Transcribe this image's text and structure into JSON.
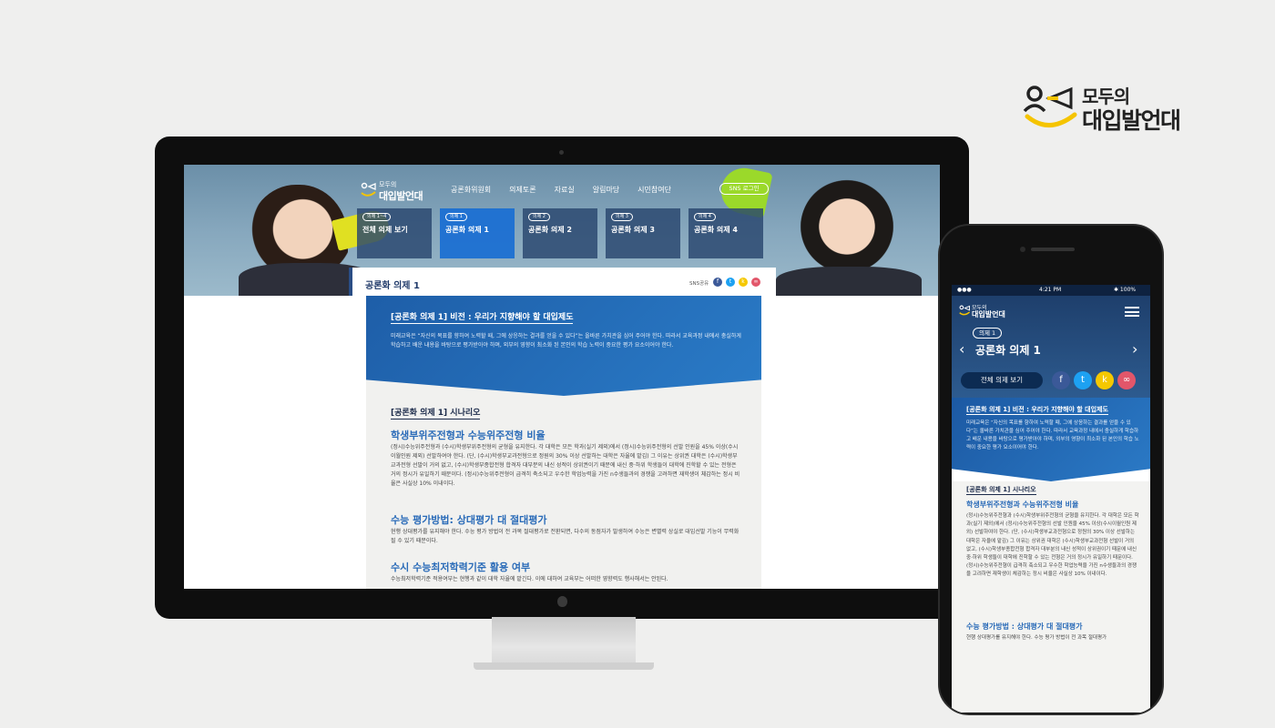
{
  "brand": {
    "line1": "모두의",
    "line2": "대입발언대"
  },
  "site": {
    "logo_line1": "모두의",
    "logo_line2": "대입발언대",
    "nav": [
      "공론화위원회",
      "의제토론",
      "자료실",
      "알림마당",
      "시민참여단"
    ],
    "sns_login": "SNS 로그인",
    "tabs": [
      {
        "badge": "의제 1~4",
        "title": "전체 의제 보기"
      },
      {
        "badge": "의제 1",
        "title": "공론화 의제 1"
      },
      {
        "badge": "의제 2",
        "title": "공론화 의제 2"
      },
      {
        "badge": "의제 3",
        "title": "공론화 의제 3"
      },
      {
        "badge": "의제 4",
        "title": "공론화 의제 4"
      }
    ],
    "active_tab": 1,
    "content_title": "공론화 의제 1",
    "share_label": "SNS공유",
    "share_icons": [
      "facebook-icon",
      "twitter-icon",
      "kakao-icon",
      "link-icon"
    ],
    "colors": {
      "accent": "#2a6bb8",
      "navy": "#1b2a4a",
      "facebook": "#3b5998",
      "twitter": "#1da1f2",
      "kakao": "#f5c800",
      "link": "#e2566a"
    }
  },
  "article": {
    "vision_title": "[공론화 의제 1] 비전 : 우리가 지향해야 할 대입제도",
    "vision_text": "미래교육은 “자신의 목표를 향하여 노력할 때, 그에 상응하는 결과를 얻을 수 있다”는 올바른 가치관을 심어 주어야 한다. 따라서 교육과정 내에서 충실하게 학습하고 배운 내용을 바탕으로 평가받아야 하며, 외부의 영향이 최소화 된 본인의 학습 노력이 중요한 평가 요소이어야 한다.",
    "scenario_title": "[공론화 의제 1] 시나리오",
    "sections": [
      {
        "title": "학생부위주전형과 수능위주전형 비율",
        "text": "(정시)수능위주전형과 (수시)학생부위주전형의 균형을 유지한다. 각 대학은 모든 학과(실기 제외)에서 (정시)수능위주전형의 선발 인원을 45% 이상(수시이월인원 제외) 선발하여야 한다. (단, (수시)학생부교과전형으로 정원의 30% 이상 선발하는 대학은 자율에 맡김) 그 이유는 상위권 대학은 (수시)학생부교과전형 선발이 거의 없고, (수시)학생부종합전형 합격자 대부분의 내신 성적이 상위권이기 때문에 내신 중·하위 학생들이 대학에 진학할 수 있는 전형은 거의 정시가 유일하기 때문이다. (정시)수능위주전형이 급격히 축소되고 우수한 학업능력을 가진 n수생들과의 경쟁을 고려하면 재학생이 체감하는 정시 비율은 사실상 10% 이내이다."
      },
      {
        "title": "수능 평가방법: 상대평가 대 절대평가",
        "text": "현행 상대평가를 유지해야 한다. 수능 평가 방법이 전 과목 절대평가로 전환되면, 다수의 동점자가 발생하여 수능은 변별력 상실로 대입선발 기능이 무력화될 수 있기 때문이다."
      },
      {
        "title": "수시 수능최저학력기준 활용 여부",
        "text": "수능최저학력기준 적용여부는 현행과 같이 대학 자율에 맡긴다. 이에 대하여 교육부는 어떠한 영향력도 행사해서는 안된다."
      }
    ]
  },
  "phone": {
    "status_left": "●●● ",
    "status_time": "4:21 PM",
    "status_battery": "✱ 100%",
    "logo_line1": "모두의",
    "logo_line2": "대입발언대",
    "badge": "의제 1",
    "title": "공론화 의제 1",
    "view_all": "전체 의제 보기",
    "vision_title": "[공론화 의제 1] 비전 : 우리가 지향해야 할 대입제도",
    "vision_text": "미래교육은 “자신의 목표를 향하여 노력할 때, 그에 상응하는 결과를 얻을 수 있다”는 올바른 가치관을 심어 주어야 한다. 따라서 교육과정 내에서 충실하게 학습하고 배운 내용을 바탕으로 평가받아야 하며, 외부의 영향이 최소화 된 본인의 학습 노력이 중요한 평가 요소이어야 한다.",
    "scenario_title": "[공론화 의제 1] 시나리오",
    "sec1_title": "학생부위주전형과 수능위주전형 비율",
    "sec1_text": "(정시)수능위주전형과 (수시)학생부위주전형의 균형을 유지한다. 각 대학은 모든 학과(실기 제외)에서 (정시)수능위주전형의 선발 인원을 45% 이상(수시이월인원 제외) 선발하여야 한다. (단, (수시)학생부교과전형으로 정원의 30% 이상 선발하는 대학은 자율에 맡김) 그 이유는 상위권 대학은 (수시)학생부교과전형 선발이 거의 없고, (수시)학생부종합전형 합격자 대부분의 내신 성적이 상위권이기 때문에 내신 중·하위 학생들이 대학에 진학할 수 있는 전형은 거의 정시가 유일하기 때문이다. (정시)수능위주전형이 급격히 축소되고 우수한 학업능력을 가진 n수생들과의 경쟁을 고려하면 재학생이 체감하는 정시 비율은 사실상 10% 이내이다.",
    "sec2_title": "수능 평가방법 : 상대평가 대 절대평가",
    "sec2_text": "현행 상대평가를 유지해야 한다. 수능 평가 방법이 전 과목 절대평가"
  }
}
